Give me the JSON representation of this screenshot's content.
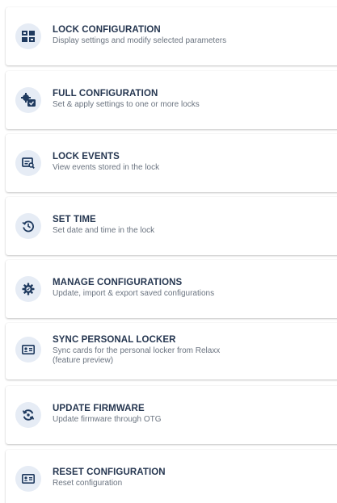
{
  "colors": {
    "icon_fill": "#1f3a5f",
    "icon_background": "#e6ecf5",
    "title_text": "#253650",
    "description_text": "#6b7480"
  },
  "menu": {
    "items": [
      {
        "icon": "grid-icon",
        "title": "LOCK CONFIGURATION",
        "description": "Display settings and modify selected parameters"
      },
      {
        "icon": "multi-settings-icon",
        "title": "FULL CONFIGURATION",
        "description": "Set & apply settings to one or more locks"
      },
      {
        "icon": "events-list-icon",
        "title": "LOCK EVENTS",
        "description": "View events stored in the lock"
      },
      {
        "icon": "clock-history-icon",
        "title": "SET TIME",
        "description": "Set date and time in the lock"
      },
      {
        "icon": "gear-icon",
        "title": "MANAGE CONFIGURATIONS",
        "description": "Update, import & export saved configurations"
      },
      {
        "icon": "id-card-icon",
        "title": "SYNC PERSONAL LOCKER",
        "description": "Sync cards for the personal locker from Relaxx",
        "description_line2": "(feature preview)"
      },
      {
        "icon": "sync-icon",
        "title": "UPDATE FIRMWARE",
        "description": "Update firmware through OTG"
      },
      {
        "icon": "id-card-icon",
        "title": "RESET CONFIGURATION",
        "description": "Reset configuration"
      }
    ]
  }
}
